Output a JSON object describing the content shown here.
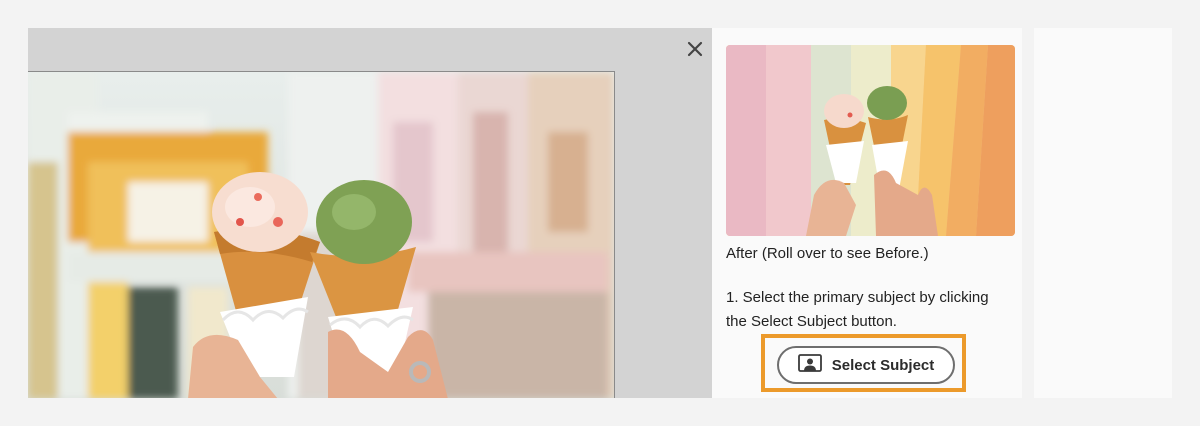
{
  "canvas": {
    "close_icon": "close-icon",
    "photo_description_icon": "photo"
  },
  "panel": {
    "caption": "After (Roll over to see Before.)",
    "step_text": "1. Select the primary subject by clicking the Select Subject button.",
    "select_subject_label": "Select Subject",
    "select_subject_icon": "person-frame-icon",
    "highlight_color": "#ec9a2b"
  }
}
